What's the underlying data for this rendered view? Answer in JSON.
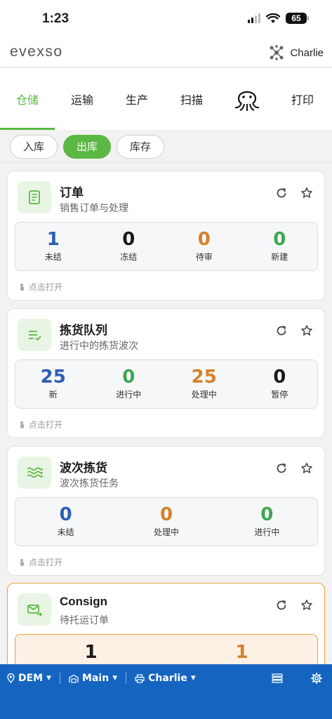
{
  "status_bar": {
    "time": "1:23",
    "battery": "65"
  },
  "header": {
    "logo": "evexso",
    "user_name": "Charlie"
  },
  "top_nav": {
    "tabs": [
      "仓储",
      "运输",
      "生产",
      "扫描",
      "打印"
    ],
    "active": "仓储"
  },
  "sub_tabs": {
    "items": [
      "入库",
      "出库",
      "库存"
    ],
    "active": "出库"
  },
  "cards": [
    {
      "title": "订单",
      "subtitle": "销售订单与处理",
      "stats": [
        {
          "value": "1",
          "label": "未结"
        },
        {
          "value": "0",
          "label": "冻结"
        },
        {
          "value": "0",
          "label": "待审"
        },
        {
          "value": "0",
          "label": "新建"
        }
      ],
      "tap_hint": "点击打开"
    },
    {
      "title": "拣货队列",
      "subtitle": "进行中的拣货波次",
      "stats": [
        {
          "value": "25",
          "label": "新"
        },
        {
          "value": "0",
          "label": "进行中"
        },
        {
          "value": "25",
          "label": "处理中"
        },
        {
          "value": "0",
          "label": "暂停"
        }
      ],
      "tap_hint": "点击打开"
    },
    {
      "title": "波次拣货",
      "subtitle": "波次拣货任务",
      "stats": [
        {
          "value": "0",
          "label": "未结"
        },
        {
          "value": "0",
          "label": "处理中"
        },
        {
          "value": "0",
          "label": "进行中"
        }
      ],
      "tap_hint": "点击打开"
    },
    {
      "title": "Consign",
      "subtitle": "待托运订单",
      "stats": [
        {
          "value": "1",
          "label": ""
        },
        {
          "value": "1",
          "label": ""
        }
      ]
    }
  ],
  "bottom_bar": {
    "location": "DEM",
    "warehouse": "Main",
    "printer": "Charlie"
  },
  "colors": {
    "accent": "#5bb844",
    "blue": "#2d5fb3",
    "orange": "#d4822a",
    "green": "#3fa750",
    "bottom_bar": "#1565c0"
  },
  "icons": [
    "signal-icon",
    "wifi-icon",
    "battery-icon",
    "network-icon",
    "octopus-icon",
    "document-icon",
    "checklist-icon",
    "waves-icon",
    "mail-forward-icon",
    "refresh-icon",
    "star-icon",
    "tap-icon",
    "location-pin-icon",
    "warehouse-icon",
    "printer-icon",
    "layers-icon",
    "gear-icon"
  ]
}
